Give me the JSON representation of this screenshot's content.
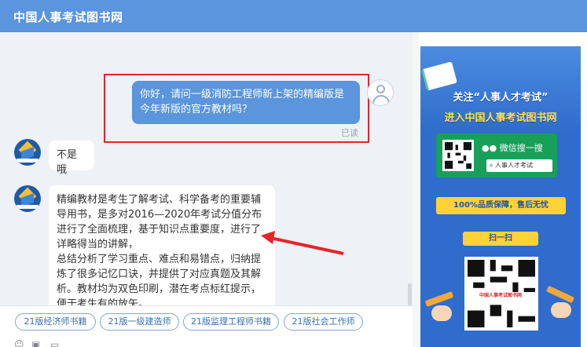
{
  "header": {
    "title": "中国人事考试图书网"
  },
  "chat": {
    "user_message": "你好，请问一级消防工程师新上架的精编版是今年新版的官方教材吗？",
    "read_status": "已读",
    "bot_reply_1": "不是哦",
    "bot_reply_2": "精编教材是考生了解考试、科学备考的重要辅导用书，是多对2016—2020年考试分值分布进行了全面梳理，基于知识点重要度，进行了详略得当的讲解，\n总结分析了学习重点、难点和易错点，归纳提炼了很多记忆口诀，并提供了对应真题及其解析。教材均为双色印刷，潜在考点标红提示，便于考生有的放矢。"
  },
  "quick_chips": [
    "21版经济师书籍",
    "21版一级建造师",
    "21版监理工程师书籍",
    "21版社会工作师"
  ],
  "toolbar": {
    "icons": [
      "emoji-icon",
      "image-icon",
      "file-icon"
    ]
  },
  "ad": {
    "line1": "关注“人事人才考试”",
    "line2": "进入中国人事考试图书网",
    "wechat_label": "微信搜一搜",
    "search_text": "人事人才考试",
    "banner": "100%品质保障，售后无忧",
    "scan": "扫一扫",
    "qr_label": "中国人事考试图书网"
  },
  "colors": {
    "accent": "#5a95dd",
    "highlight": "#e3262b",
    "ad_blue": "#2f6ccb",
    "ad_yellow": "#ffd335",
    "wechat_green": "#18a05a"
  }
}
